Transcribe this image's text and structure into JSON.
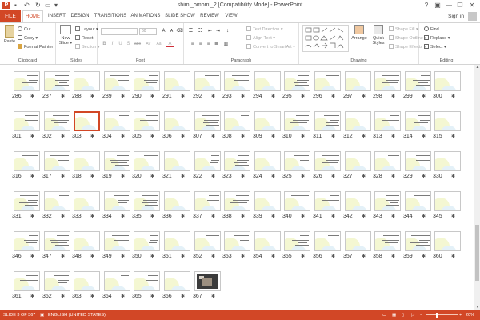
{
  "titlebar": {
    "logo": "P",
    "title": "shimi_omomi_2 [Compatibility Mode] - PowerPoint",
    "help": "?",
    "minimize": "—",
    "restore": "❐",
    "close": "✕"
  },
  "tabs": {
    "file": "FILE",
    "items": [
      "HOME",
      "INSERT",
      "DESIGN",
      "TRANSITIONS",
      "ANIMATIONS",
      "SLIDE SHOW",
      "REVIEW",
      "VIEW"
    ],
    "active": "HOME",
    "signin": "Sign in"
  },
  "ribbon": {
    "clipboard": {
      "paste": "Paste",
      "cut": "Cut",
      "copy": "Copy",
      "format_painter": "Format Painter",
      "label": "Clipboard"
    },
    "slides": {
      "new_slide": "New Slide",
      "layout": "Layout",
      "reset": "Reset",
      "section": "Section",
      "label": "Slides"
    },
    "font": {
      "size": "60",
      "label": "Font",
      "format_buttons": [
        "B",
        "I",
        "U",
        "S",
        "abc",
        "AV",
        "Aa",
        "A"
      ]
    },
    "paragraph": {
      "text_direction": "Text Direction",
      "align_text": "Align Text",
      "convert": "Convert to SmartArt",
      "label": "Paragraph"
    },
    "drawing": {
      "arrange": "Arrange",
      "quick_styles": "Quick Styles",
      "shape_fill": "Shape Fill",
      "shape_outline": "Shape Outline",
      "shape_effects": "Shape Effects",
      "label": "Drawing"
    },
    "editing": {
      "find": "Find",
      "replace": "Replace",
      "select": "Select",
      "label": "Editing"
    }
  },
  "slides": {
    "rows": [
      {
        "numbers": [
          286,
          287,
          288,
          289,
          290,
          291,
          292,
          293,
          294,
          295,
          296,
          297,
          298,
          299,
          300
        ]
      },
      {
        "numbers": [
          301,
          302,
          303,
          304,
          305,
          306,
          307,
          308,
          309,
          310,
          311,
          312,
          313,
          314,
          315
        ]
      },
      {
        "numbers": [
          316,
          317,
          318,
          319,
          320,
          321,
          322,
          323,
          324,
          325,
          326,
          327,
          328,
          329,
          330
        ]
      },
      {
        "numbers": [
          331,
          332,
          333,
          334,
          335,
          336,
          337,
          338,
          339,
          340,
          341,
          342,
          343,
          344,
          345
        ]
      },
      {
        "numbers": [
          346,
          347,
          348,
          349,
          350,
          351,
          352,
          353,
          354,
          355,
          356,
          357,
          358,
          359,
          360
        ]
      },
      {
        "numbers": [
          361,
          362,
          363,
          364,
          365,
          366,
          367
        ]
      }
    ],
    "selected": 303,
    "star": "✱"
  },
  "statusbar": {
    "slide_info": "SLIDE 3 OF 367",
    "language": "ENGLISH (UNITED STATES)",
    "zoom": "20%",
    "zoom_minus": "−",
    "zoom_plus": "+"
  },
  "colors": {
    "accent": "#d24726"
  }
}
